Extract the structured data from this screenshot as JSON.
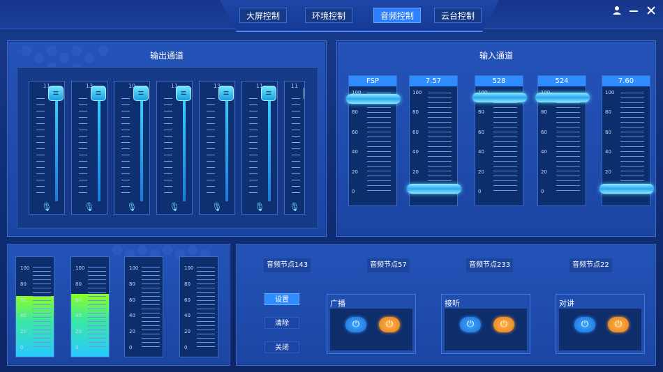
{
  "tabs": [
    {
      "label": "大屏控制",
      "active": false
    },
    {
      "label": "环境控制",
      "active": false
    },
    {
      "label": "音频控制",
      "active": true
    },
    {
      "label": "云台控制",
      "active": false
    }
  ],
  "window": {
    "user_icon": "user-icon",
    "min_icon": "minimize-icon",
    "close_icon": "close-icon"
  },
  "output": {
    "title": "输出通道",
    "channels": [
      {
        "num": "11",
        "level": 1.0
      },
      {
        "num": "13",
        "level": 1.0
      },
      {
        "num": "10",
        "level": 1.0
      },
      {
        "num": "11",
        "level": 1.0
      },
      {
        "num": "13",
        "level": 1.0
      },
      {
        "num": "11",
        "level": 1.0
      },
      {
        "num": "11",
        "level": 1.0
      }
    ]
  },
  "input": {
    "title": "输入通道",
    "scale": [
      "100",
      "80",
      "60",
      "40",
      "20",
      "0"
    ],
    "channels": [
      {
        "name": "FSP",
        "level": 94
      },
      {
        "name": "7.57",
        "level": 3
      },
      {
        "name": "528",
        "level": 95
      },
      {
        "name": "524",
        "level": 95
      },
      {
        "name": "7.60",
        "level": 3
      }
    ]
  },
  "meters": {
    "scale": [
      "100",
      "80",
      "60",
      "40",
      "20",
      "0"
    ],
    "levels": [
      60,
      62,
      0,
      0
    ]
  },
  "nodes": [
    "音频节点143",
    "音频节点57",
    "音频节点233",
    "音频节点22"
  ],
  "settings": [
    {
      "label": "设置",
      "active": true
    },
    {
      "label": "清除",
      "active": false
    },
    {
      "label": "关闭",
      "active": false
    }
  ],
  "groups": [
    {
      "title": "广播"
    },
    {
      "title": "接听"
    },
    {
      "title": "对讲"
    }
  ],
  "colors": {
    "accent": "#2f8cff",
    "power_blue": "#2f8cff",
    "power_orange": "#f09a30"
  }
}
